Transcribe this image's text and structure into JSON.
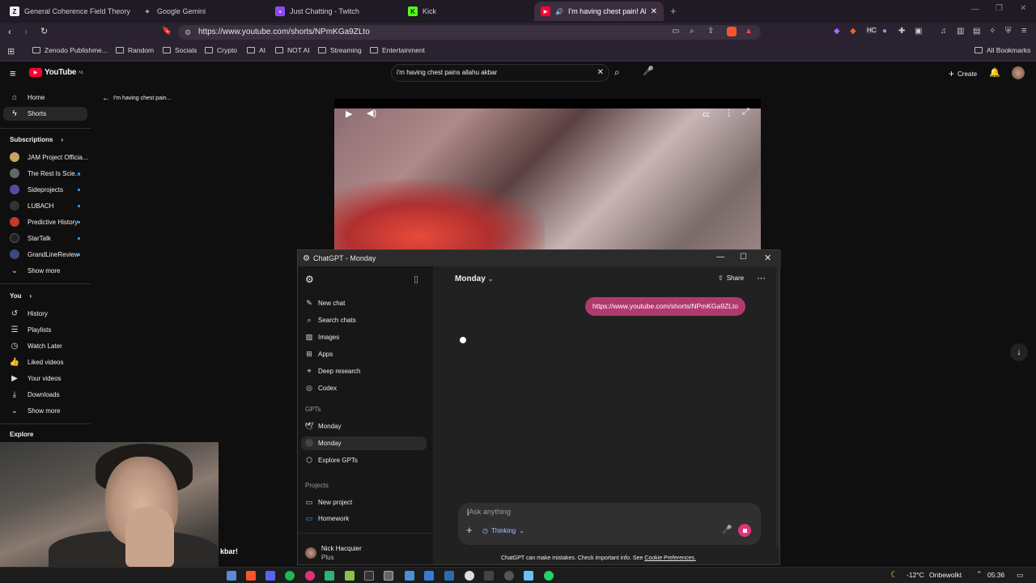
{
  "browser": {
    "tabs": [
      {
        "title": "General Coherence Field Theory (GC"
      },
      {
        "title": "Google Gemini"
      },
      {
        "title": "Just Chatting - Twitch"
      },
      {
        "title": "Kick"
      },
      {
        "title": "I'm having chest pain! Allahu"
      }
    ],
    "url": "https://www.youtube.com/shorts/NPmKGa9ZLto",
    "bookmarks": [
      "Zenodo Publishme...",
      "Random",
      "Socials",
      "Crypto",
      "AI",
      "NOT AI",
      "Streaming",
      "Entertainment"
    ],
    "all_bookmarks": "All Bookmarks"
  },
  "youtube": {
    "logo": "YouTube",
    "logo_region": "NL",
    "search_value": "i'm having chest pains allahu akbar",
    "create_label": "Create",
    "back_title": "I'm having chest pain...",
    "nav": {
      "home": "Home",
      "shorts": "Shorts"
    },
    "subscriptions_label": "Subscriptions",
    "subscriptions": [
      {
        "name": "JAM Project Officia...",
        "color": "#c8a45a"
      },
      {
        "name": "The Rest Is Scie...",
        "color": "#666666"
      },
      {
        "name": "Sideprojects",
        "color": "#5a4a9a"
      },
      {
        "name": "LUBACH",
        "color": "#333333"
      },
      {
        "name": "Predictive History",
        "color": "#c0392b"
      },
      {
        "name": "StarTalk",
        "color": "#222222"
      },
      {
        "name": "GrandLineReview",
        "color": "#3a4a7a"
      }
    ],
    "show_more": "Show more",
    "you_label": "You",
    "you_items": [
      "History",
      "Playlists",
      "Watch Later",
      "Liked videos",
      "Your videos",
      "Downloads"
    ],
    "show_more_2": "Show more",
    "explore_label": "Explore",
    "overlay_caption": "kbar!"
  },
  "chatgpt": {
    "window_title": "ChatGPT - Monday",
    "sidebar": {
      "items": [
        "New chat",
        "Search chats",
        "Images",
        "Apps",
        "Deep research",
        "Codex"
      ],
      "gpts_header": "GPTs",
      "gpts": [
        "Monday",
        "Monday",
        "Explore GPTs"
      ],
      "projects_header": "Projects",
      "projects": [
        "New project",
        "Homework"
      ],
      "user_name": "Nick Hacquier",
      "user_plan": "Plus"
    },
    "model_name": "Monday",
    "share_label": "Share",
    "user_message": "https://www.youtube.com/shorts/NPmKGa9ZLto",
    "composer_placeholder": "Ask anything",
    "thinking_label": "Thinking",
    "disclaimer": "ChatGPT can make mistakes. Check important info. See",
    "cookie_link": "Cookie Preferences."
  },
  "taskbar": {
    "weather": "-12°C",
    "weather_desc": "Onbewolkt",
    "time": "05:36"
  },
  "colors": {
    "accent_pink": "#b03a6e",
    "youtube_red": "#ff0033",
    "stop_button": "#e0337a"
  }
}
